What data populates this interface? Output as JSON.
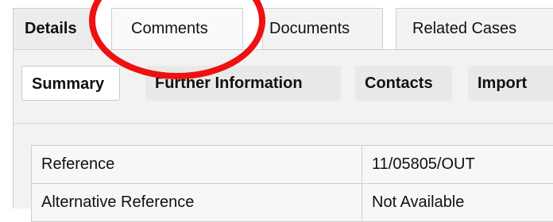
{
  "tabs": {
    "details": "Details",
    "comments": "Comments",
    "documents": "Documents",
    "related_cases": "Related Cases"
  },
  "subtabs": {
    "summary": "Summary",
    "further_information": "Further Information",
    "contacts": "Contacts",
    "import": "Import"
  },
  "details_table": {
    "rows": [
      {
        "label": "Reference",
        "value": "11/05805/OUT"
      },
      {
        "label": "Alternative Reference",
        "value": "Not Available"
      }
    ]
  },
  "annotation": {
    "color": "#ee1111"
  }
}
